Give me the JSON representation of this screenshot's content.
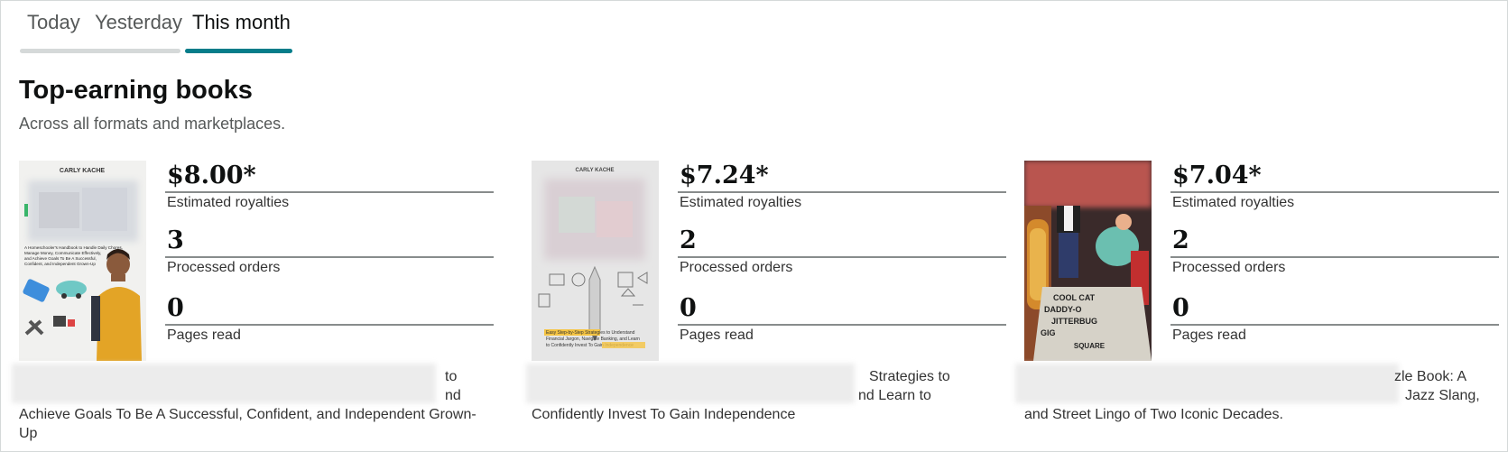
{
  "tabs": [
    {
      "label": "Today",
      "active": false
    },
    {
      "label": "Yesterday",
      "active": false
    },
    {
      "label": "This month",
      "active": true
    }
  ],
  "section": {
    "title": "Top-earning books",
    "subtitle": "Across all formats and marketplaces."
  },
  "books": [
    {
      "cover": {
        "author": "CARLY KACHE",
        "blurb": "A Homeschooler's Handbook to Handle Daily Chores, Manage Money, Communicate Effectively, and Achieve Goals To Be A Successful, Confident, and Independent Grown-Up"
      },
      "royalties": "$8.00*",
      "royalties_label": "Estimated royalties",
      "orders": "3",
      "orders_label": "Processed orders",
      "pages": "0",
      "pages_label": "Pages read",
      "title_visible": {
        "line1_end": "to",
        "line2_end": "nd",
        "line3": "Achieve Goals To Be A Successful, Confident, and Independent Grown-",
        "line4": "Up"
      }
    },
    {
      "cover": {
        "author": "CARLY KACHE",
        "blurb": "Easy Step-by-Step Strategies to Understand Financial Jargon, Navigate Banking, and Learn to Confidently Invest To Gain Independence"
      },
      "royalties": "$7.24*",
      "royalties_label": "Estimated royalties",
      "orders": "2",
      "orders_label": "Processed orders",
      "pages": "0",
      "pages_label": "Pages read",
      "title_visible": {
        "line1_end": "Strategies to",
        "line2_end": "nd Learn to",
        "line3": "Confidently Invest To Gain Independence"
      }
    },
    {
      "cover": {
        "puzzle_words": "COOL CAT · DADDY-O · JITTERBUG · GIG",
        "footer": "SQUARE"
      },
      "royalties": "$7.04*",
      "royalties_label": "Estimated royalties",
      "orders": "2",
      "orders_label": "Processed orders",
      "pages": "0",
      "pages_label": "Pages read",
      "title_visible": {
        "line1_end": "zle Book: A",
        "line2_end": "Jazz Slang,",
        "line3": "and Street Lingo of Two Iconic Decades."
      }
    }
  ],
  "colors": {
    "tab_active_bar": "#067d8a",
    "tab_inactive_bar": "#d5d9d9",
    "highlight": "#f5c443"
  }
}
